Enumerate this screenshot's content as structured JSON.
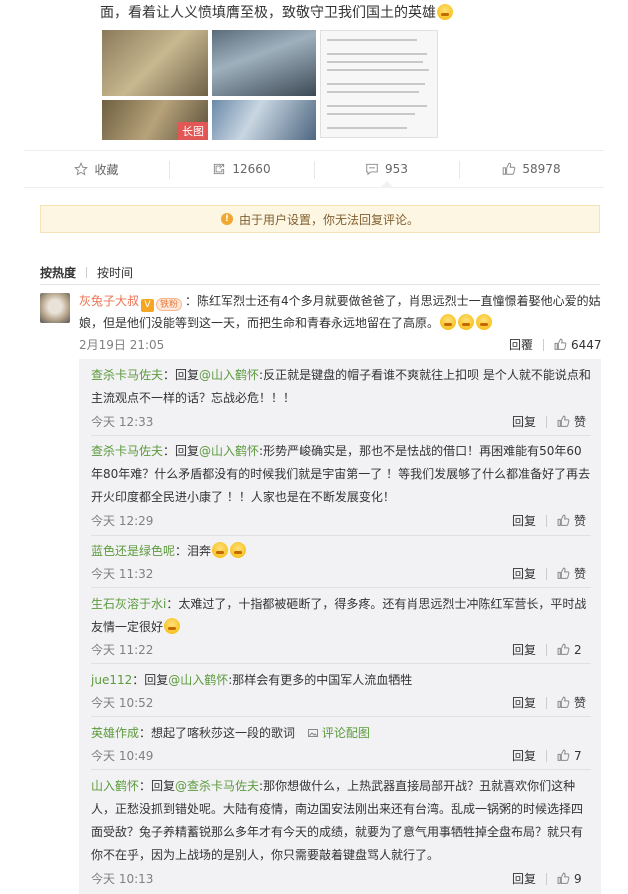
{
  "post": {
    "text_tail": "面，看着让人义愤填膺至极，致敬守卫我们国土的英雄",
    "long_image_tag": "长图"
  },
  "actions": {
    "favorite": "收藏",
    "repost_count": "12660",
    "comment_count": "953",
    "like_count": "58978"
  },
  "notice": "由于用户设置，你无法回复评论。",
  "sort": {
    "hot": "按热度",
    "time": "按时间"
  },
  "main_comment": {
    "user": "灰兔子大叔",
    "badge": "V",
    "fan_badge": "铁粉",
    "text": "：陈红军烈士还有4个多月就要做爸爸了，肖思远烈士一直憧憬着娶他心爱的姑娘，但是他们没能等到这一天，而把生命和青春永远地留在了高原。",
    "time": "2月19日 21:05",
    "reply_label": "回覆",
    "like_count": "6447"
  },
  "replies": [
    {
      "user": "查杀卡马佐夫",
      "reply_prefix": "：回复",
      "mention": "@山入鹤怀",
      "text": ":反正就是键盘的帽子看谁不爽就往上扣呗 是个人就不能说点和主流观点不一样的话？忘战必危！！！",
      "time": "今天 12:33",
      "reply_label": "回复",
      "like": "赞"
    },
    {
      "user": "查杀卡马佐夫",
      "reply_prefix": "：回复",
      "mention": "@山入鹤怀",
      "text": ":形势严峻确实是，那也不是怯战的借口！再困难能有50年60年80年难？什么矛盾都没有的时候我们就是宇宙第一了 ！等我们发展够了什么都准备好了再去开火印度都全民进小康了 ！！人家也是在不断发展变化！",
      "time": "今天 12:29",
      "reply_label": "回复",
      "like": "赞"
    },
    {
      "user": "蓝色还是绿色呢",
      "text": "：泪奔",
      "time": "今天 11:32",
      "reply_label": "回复",
      "like": "赞"
    },
    {
      "user": "生石灰溶于水i",
      "text": "：太难过了，十指都被砸断了，得多疼。还有肖思远烈士冲陈红军营长，平时战友情一定很好",
      "time": "今天 11:22",
      "reply_label": "回复",
      "like": "2"
    },
    {
      "user": "jue112",
      "reply_prefix": "：回复",
      "mention": "@山入鹤怀",
      "text": ":那样会有更多的中国军人流血牺牲",
      "time": "今天 10:52",
      "reply_label": "回复",
      "like": "赞"
    },
    {
      "user": "英雄作成",
      "text": "：想起了喀秋莎这一段的歌词",
      "img_link": "评论配图",
      "time": "今天 10:49",
      "reply_label": "回复",
      "like": "7"
    },
    {
      "user": "山入鹤怀",
      "reply_prefix": "：回复",
      "mention": "@查杀卡马佐夫",
      "text": ":那你想做什么，上热武器直接局部开战？丑就喜欢你们这种人，正愁没抓到错处呢。大陆有疫情，南边国安法刚出来还有台湾。乱成一锅粥的时候选择四面受敌？兔子养精蓄锐那么多年才有今天的成绩，就要为了意气用事牺牲掉全盘布局？就只有你不在乎，因为上战场的是别人，你只需要敲着键盘骂人就行了。",
      "time": "今天 10:13",
      "reply_label": "回复",
      "like": "9"
    }
  ]
}
